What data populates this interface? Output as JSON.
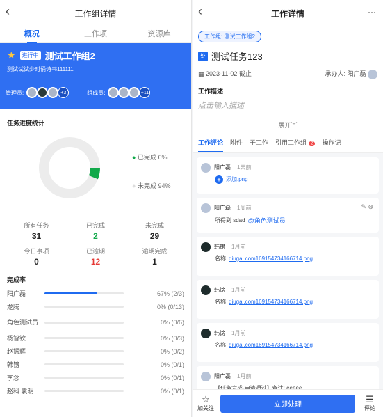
{
  "left": {
    "title": "工作组详情",
    "tabs": [
      "概况",
      "工作项",
      "资源库"
    ],
    "banner": {
      "status": "进行中",
      "name": "测试工作组2",
      "desc": "测试试试少时诵诗书111111",
      "managers_label": "管理员:",
      "managers_more": "+3",
      "members_label": "组成员:",
      "members_more": "+11"
    },
    "progress_title": "任务进度统计",
    "legend": {
      "done": "已完成 6%",
      "undone": "未完成 94%"
    },
    "progress": {
      "done": 6,
      "undone": 94
    },
    "stats": [
      {
        "label": "所有任务",
        "value": "31"
      },
      {
        "label": "已完成",
        "value": "2"
      },
      {
        "label": "未完成",
        "value": "29"
      },
      {
        "label": "今日事项",
        "value": "0"
      },
      {
        "label": "已逾期",
        "value": "12"
      },
      {
        "label": "逾期完成",
        "value": "1"
      }
    ],
    "rate_title": "完成率",
    "rates": [
      {
        "name": "阳广磊",
        "pct": "67% (2/3)",
        "fill": 0.67
      },
      {
        "name": "龙腾",
        "pct": "0% (0/13)",
        "fill": 0
      },
      {
        "name": "角色测试员",
        "pct": "0% (0/6)",
        "fill": 0
      },
      {
        "name": "杨智钦",
        "pct": "0% (0/3)",
        "fill": 0
      },
      {
        "name": "赵振辉",
        "pct": "0% (0/2)",
        "fill": 0
      },
      {
        "name": "韩镑",
        "pct": "0% (0/1)",
        "fill": 0
      },
      {
        "name": "李念",
        "pct": "0% (0/1)",
        "fill": 0
      },
      {
        "name": "赵科 袁明",
        "pct": "0% (0/1)",
        "fill": 0
      }
    ]
  },
  "right": {
    "title": "工作详情",
    "more": "···",
    "group_pill": "工作组: 测试工作组2",
    "badge": "处",
    "task_name": "测试任务123",
    "due": "2023-11-02 截止",
    "assignee": "承办人: 阳广磊",
    "desc_label": "工作描述",
    "desc_placeholder": "点击输入描述",
    "expand": "展开",
    "tabs": [
      "工作评论",
      "附件",
      "子工作",
      "引用工作组",
      "操作记"
    ],
    "tab_count": "2",
    "comments": [
      {
        "user": "阳广磊",
        "time": "1天前",
        "text": "添加.png",
        "type": "add"
      },
      {
        "user": "阳广磊",
        "time": "1周前",
        "text": "所得到 sdad",
        "mention": "@角色测试员",
        "type": "mention"
      },
      {
        "user": "韩镑",
        "time": "1月前",
        "prefix": "名称",
        "text": "diugai.com169154734166714.png",
        "type": "file"
      },
      {
        "user": "韩镑",
        "time": "1月前",
        "prefix": "名称",
        "text": "diugai.com169154734166714.png",
        "type": "file"
      },
      {
        "user": "韩镑",
        "time": "1月前",
        "prefix": "名称",
        "text": "diugai.com169154734166714.png",
        "type": "file"
      },
      {
        "user": "阳广磊",
        "time": "1月前",
        "text": "【任务完成-申请通过】备注: eeeee",
        "type": "text"
      }
    ],
    "bottom": {
      "follow": "加关注",
      "primary": "立即处理",
      "comment": "评论"
    }
  }
}
